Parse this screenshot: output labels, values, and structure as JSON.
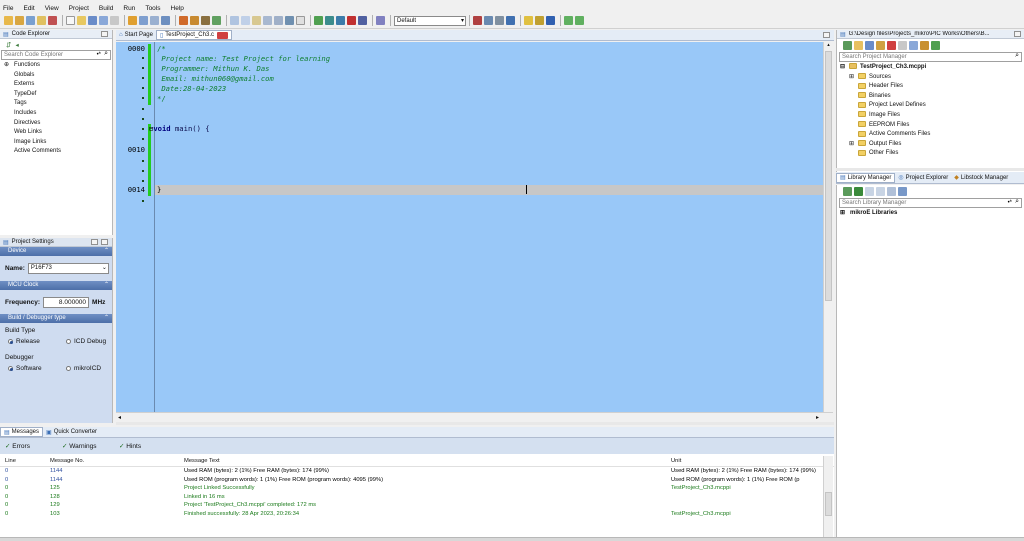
{
  "menu": [
    "File",
    "Edit",
    "View",
    "Project",
    "Build",
    "Run",
    "Tools",
    "Help"
  ],
  "toolbar": {
    "config_value": "Default"
  },
  "code_explorer": {
    "title": "Code Explorer",
    "search_placeholder": "Search Code Explorer",
    "items": [
      "Functions",
      "Globals",
      "Externs",
      "TypeDef",
      "Tags",
      "Includes",
      "Directives",
      "Web Links",
      "Image Links",
      "Active Comments"
    ]
  },
  "project_settings": {
    "title": "Project Settings",
    "device_section": "Device",
    "name_label": "Name:",
    "name_value": "P16F73",
    "clock_section": "MCU Clock",
    "freq_label": "Frequency:",
    "freq_value": "8.000000",
    "freq_unit": "MHz",
    "build_section": "Build / Debugger type",
    "build_type_label": "Build Type",
    "release_label": "Release",
    "icd_label": "ICD Debug",
    "debugger_label": "Debugger",
    "software_label": "Software",
    "mikroicd_label": "mikroICD"
  },
  "tabs": {
    "start_page": "Start Page",
    "file": "TestProject_Ch3.c"
  },
  "editor": {
    "line_numbers": {
      "l0": "0000",
      "l10": "0010",
      "l14": "0014"
    },
    "comment_open": "/*",
    "comment_lines": [
      " Project name: Test Project for learning",
      " Programmer: Mithun K. Das",
      " Email: mithun060@gmail.com",
      " Date:28-04-2023"
    ],
    "comment_close": "*/",
    "keyword_void": "void",
    "main_sig": " main() {",
    "close_brace": "}"
  },
  "project_manager": {
    "path": "G:\\Design files\\Projects_mikro\\PIC Works\\Others\\B...",
    "search_placeholder": "Search Project Manager",
    "root": "TestProject_Ch3.mcppi",
    "folders": [
      "Sources",
      "Header Files",
      "Binaries",
      "Project Level Defines",
      "Image Files",
      "EEPROM Files",
      "Active Comments Files",
      "Output Files",
      "Other Files"
    ]
  },
  "library_tabs": [
    "Library Manager",
    "Project Explorer",
    "Libstock Manager"
  ],
  "library": {
    "search_placeholder": "Search Library Manager",
    "root": "mikroE Libraries"
  },
  "bottom_tabs": {
    "messages": "Messages",
    "quick_converter": "Quick Converter"
  },
  "filters": {
    "errors": "Errors",
    "warnings": "Warnings",
    "hints": "Hints"
  },
  "messages": {
    "headers": {
      "line": "Line",
      "msg_no": "Message No.",
      "text": "Message Text",
      "unit": "Unit"
    },
    "rows": [
      {
        "line": "0",
        "no": "1144",
        "text": "Used RAM (bytes): 2 (1%)  Free RAM (bytes): 174 (99%)",
        "unit": "Used RAM (bytes): 2 (1%)  Free RAM (bytes): 174 (99%)",
        "color": "#000000"
      },
      {
        "line": "0",
        "no": "1144",
        "text": "Used ROM (program words): 1 (1%)  Free ROM (program words): 4095 (99%)",
        "unit": "Used ROM (program words): 1 (1%)  Free ROM (p",
        "color": "#000000"
      },
      {
        "line": "0",
        "no": "125",
        "text": "Project Linked Successfully",
        "unit": "TestProject_Ch3.mcppi",
        "color": "#1a7a1a"
      },
      {
        "line": "0",
        "no": "128",
        "text": "Linked in 16 ms",
        "unit": "",
        "color": "#1a7a1a"
      },
      {
        "line": "0",
        "no": "129",
        "text": "Project 'TestProject_Ch3.mcppi' completed: 172 ms",
        "unit": "",
        "color": "#1a7a1a"
      },
      {
        "line": "0",
        "no": "103",
        "text": "Finished successfully: 28 Apr 2023, 20:26:34",
        "unit": "TestProject_Ch3.mcppi",
        "color": "#1a7a1a"
      }
    ]
  },
  "colors": {
    "editor_bg": "#99c8f8",
    "comment": "#0f7f2f",
    "gutter_marker": "#22cc22",
    "current_line": "#c7c7c7",
    "panel_band": "#5577b0",
    "message_ok": "#1a7a1a"
  }
}
